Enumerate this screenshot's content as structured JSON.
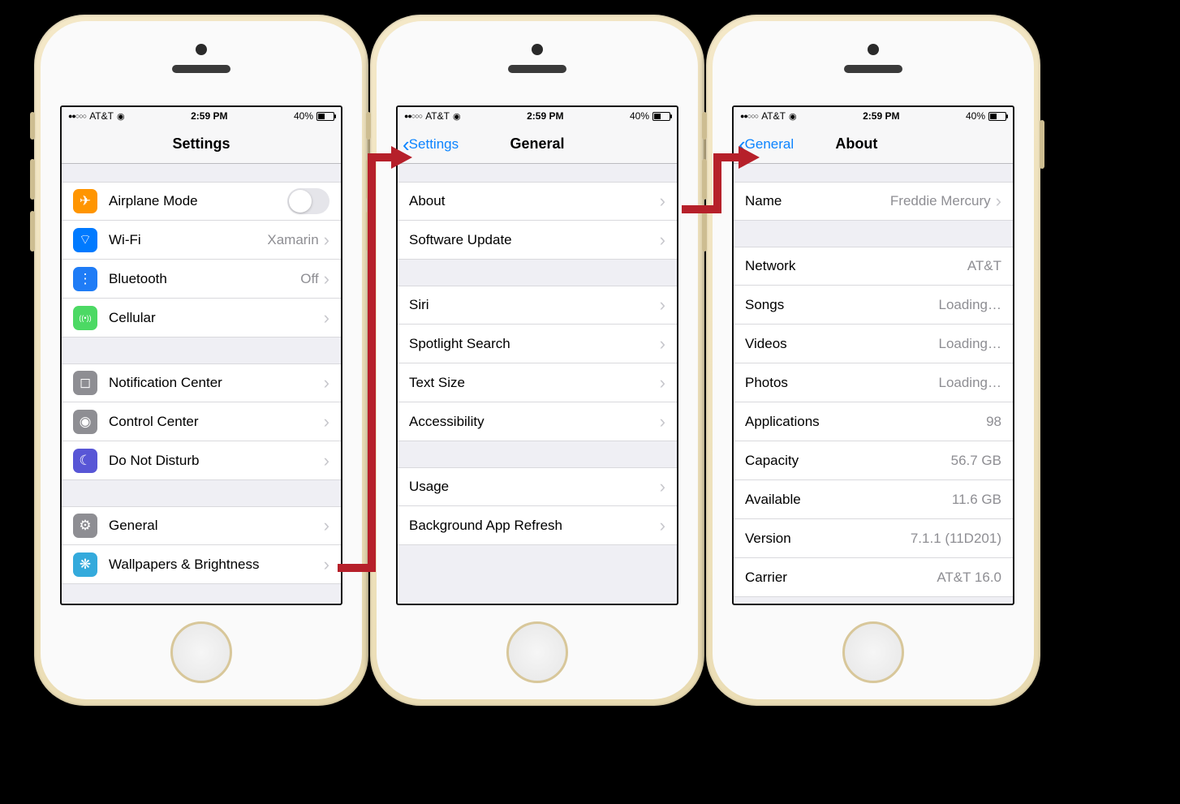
{
  "status": {
    "carrier": "AT&T",
    "time": "2:59 PM",
    "battery": "40%"
  },
  "screen1": {
    "title": "Settings",
    "g1": [
      {
        "icon": "airplane-icon",
        "cls": "ic-orange",
        "glyph": "✈",
        "label": "Airplane Mode",
        "toggle": true
      },
      {
        "icon": "wifi-icon",
        "cls": "ic-blue",
        "glyph": "⌔",
        "label": "Wi-Fi",
        "value": "Xamarin"
      },
      {
        "icon": "bluetooth-icon",
        "cls": "ic-bt",
        "glyph": "⋮",
        "label": "Bluetooth",
        "value": "Off"
      },
      {
        "icon": "cellular-icon",
        "cls": "ic-green",
        "glyph": "((•))",
        "label": "Cellular"
      }
    ],
    "g2": [
      {
        "icon": "notification-icon",
        "cls": "ic-gray",
        "glyph": "◻",
        "label": "Notification Center"
      },
      {
        "icon": "control-icon",
        "cls": "ic-gray",
        "glyph": "◉",
        "label": "Control Center"
      },
      {
        "icon": "dnd-icon",
        "cls": "ic-purple",
        "glyph": "☾",
        "label": "Do Not Disturb"
      }
    ],
    "g3": [
      {
        "icon": "general-icon",
        "cls": "ic-gray",
        "glyph": "⚙",
        "label": "General"
      },
      {
        "icon": "wallpaper-icon",
        "cls": "ic-cyan",
        "glyph": "❋",
        "label": "Wallpapers & Brightness"
      }
    ]
  },
  "screen2": {
    "back": "Settings",
    "title": "General",
    "g1": [
      {
        "label": "About"
      },
      {
        "label": "Software Update"
      }
    ],
    "g2": [
      {
        "label": "Siri"
      },
      {
        "label": "Spotlight Search"
      },
      {
        "label": "Text Size"
      },
      {
        "label": "Accessibility"
      }
    ],
    "g3": [
      {
        "label": "Usage"
      },
      {
        "label": "Background App Refresh"
      }
    ]
  },
  "screen3": {
    "back": "General",
    "title": "About",
    "g1": [
      {
        "label": "Name",
        "value": "Freddie Mercury",
        "chev": true
      }
    ],
    "g2": [
      {
        "label": "Network",
        "value": "AT&T"
      },
      {
        "label": "Songs",
        "value": "Loading…"
      },
      {
        "label": "Videos",
        "value": "Loading…"
      },
      {
        "label": "Photos",
        "value": "Loading…"
      },
      {
        "label": "Applications",
        "value": "98"
      },
      {
        "label": "Capacity",
        "value": "56.7 GB"
      },
      {
        "label": "Available",
        "value": "11.6 GB"
      },
      {
        "label": "Version",
        "value": "7.1.1 (11D201)"
      },
      {
        "label": "Carrier",
        "value": "AT&T 16.0"
      }
    ]
  }
}
